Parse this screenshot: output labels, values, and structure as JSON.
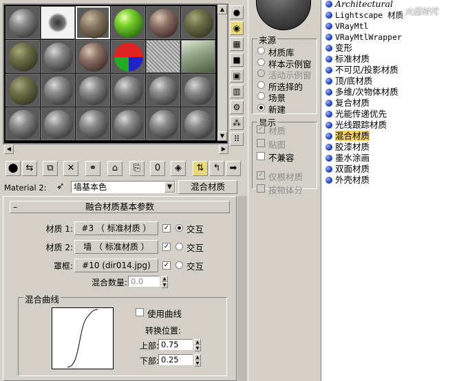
{
  "material_slots": [
    "gray",
    "white-tex",
    "stone",
    "green",
    "mixed",
    "moss",
    "moss",
    "gray",
    "mixed",
    "rgb",
    "noise",
    "photo",
    "moss",
    "gray",
    "gray",
    "gray",
    "gray",
    "gray",
    "gray",
    "gray",
    "gray",
    "gray",
    "gray",
    "gray"
  ],
  "toolbar_icons": [
    "get-material-icon",
    "put-to-scene-icon",
    "assign-to-selection-icon",
    "reset-icon",
    "make-copy-icon",
    "make-unique-icon",
    "put-to-library-icon",
    "material-effects-channel-icon",
    "show-map-icon",
    "show-end-result-icon",
    "go-to-parent-icon",
    "go-forward-to-sibling-icon"
  ],
  "side_icons": [
    "sample-type-icon",
    "backlight-icon",
    "background-icon",
    "sample-uv-tiling-icon",
    "video-color-check-icon",
    "make-preview-icon",
    "options-icon",
    "select-by-material-icon",
    "material-navigator-icon"
  ],
  "material_name_row": {
    "label": "Material 2:",
    "name": "墙基本色",
    "type_button": "混合材质"
  },
  "rollout": {
    "title": "融合材质基本参数",
    "rows": [
      {
        "label": "材质 1:",
        "button": "#3 （ 标准材质 ）",
        "checked": "✓",
        "radio_label": "交互",
        "radio_on": true
      },
      {
        "label": "材质 2:",
        "button": "墙 （ 标准材质 ）",
        "checked": "✓",
        "radio_label": "交互",
        "radio_on": false
      },
      {
        "label": "罩框:",
        "button": "#10 (dir014.jpg)",
        "checked": "✓",
        "radio_label": "交互",
        "radio_on": false
      }
    ],
    "mix_amount_label": "混合数量:",
    "mix_amount_value": "0.0",
    "curve_group": "混合曲线",
    "use_curve_label": "使用曲线",
    "transition_label": "转换位置:",
    "upper_label": "上部:",
    "upper_value": "0.75",
    "lower_label": "下部:",
    "lower_value": "0.25"
  },
  "browse_from": {
    "title": "来源",
    "options": [
      {
        "label": "材质库",
        "enabled": true,
        "on": false
      },
      {
        "label": "样本示例窗",
        "enabled": true,
        "on": false
      },
      {
        "label": "活动示例窗",
        "enabled": false,
        "on": false
      },
      {
        "label": "所选择的",
        "enabled": true,
        "on": false
      },
      {
        "label": "场景",
        "enabled": true,
        "on": false
      },
      {
        "label": "新建",
        "enabled": true,
        "on": true
      }
    ]
  },
  "show": {
    "title": "显示",
    "options": [
      {
        "label": "材质",
        "checked": true,
        "enabled": false
      },
      {
        "label": "贴图",
        "checked": false,
        "enabled": false
      },
      {
        "label": "不兼容",
        "checked": false,
        "enabled": true
      }
    ],
    "options2": [
      {
        "label": "仅根材质",
        "checked": true,
        "enabled": false
      },
      {
        "label": "按物体分",
        "checked": false,
        "enabled": false
      }
    ]
  },
  "material_list": [
    {
      "label": "Architectural",
      "mono": false,
      "italic": true
    },
    {
      "label": "Lightscape 材质",
      "mono": true
    },
    {
      "label": "VRayMtl",
      "mono": true
    },
    {
      "label": "VRayMtlWrapper",
      "mono": true
    },
    {
      "label": "变形",
      "mono": false
    },
    {
      "label": "标准材质",
      "mono": false
    },
    {
      "label": "不可见/投影材质",
      "mono": false
    },
    {
      "label": "顶/底材质",
      "mono": false
    },
    {
      "label": "多维/次物体材质",
      "mono": false
    },
    {
      "label": "复合材质",
      "mono": false
    },
    {
      "label": "光能传递优先",
      "mono": false
    },
    {
      "label": "光线跟踪材质",
      "mono": false
    },
    {
      "label": "混合材质",
      "mono": false,
      "selected": true
    },
    {
      "label": "胶漆材质",
      "mono": false
    },
    {
      "label": "墨水涂画",
      "mono": false
    },
    {
      "label": "双面材质",
      "mono": false
    },
    {
      "label": "外壳材质",
      "mono": false
    }
  ],
  "watermark": "火星时代"
}
